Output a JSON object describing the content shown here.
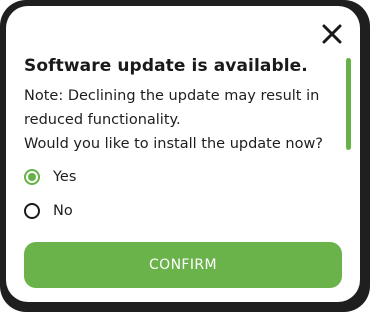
{
  "dialog": {
    "title": "Software update is available.",
    "body_lines": [
      "Note: Declining the update may result in",
      "reduced functionality.",
      "Would you like to install the update now?"
    ],
    "close_icon": "close-icon",
    "options": [
      {
        "label": "Yes",
        "selected": true
      },
      {
        "label": "No",
        "selected": false
      }
    ],
    "confirm_label": "CONFIRM"
  },
  "colors": {
    "accent": "#66b247",
    "frame": "#1f1f1f",
    "text": "#1a1a1a",
    "background": "#ffffff"
  }
}
